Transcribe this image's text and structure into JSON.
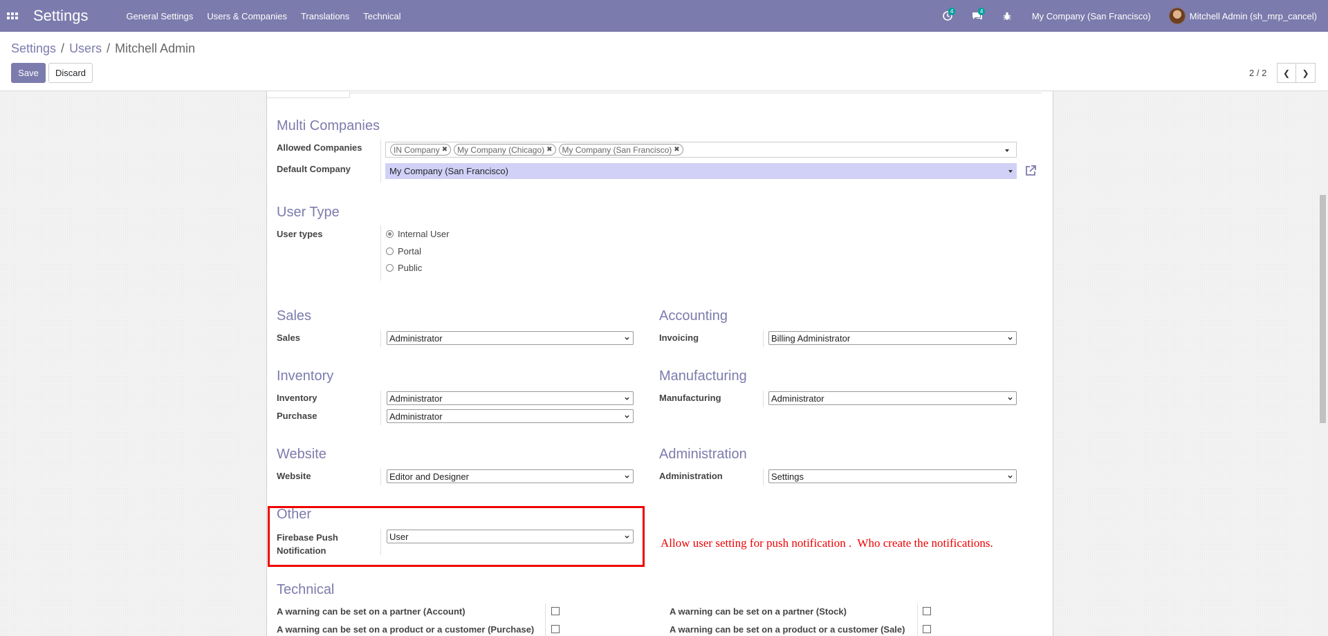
{
  "navbar": {
    "app_title": "Settings",
    "menu": [
      "General Settings",
      "Users & Companies",
      "Translations",
      "Technical"
    ],
    "activity_count": "4",
    "messages_count": "4",
    "company": "My Company (San Francisco)",
    "user": "Mitchell Admin (sh_mrp_cancel)",
    "accent_color": "#7c7bad"
  },
  "breadcrumb": [
    "Settings",
    "Users",
    "Mitchell Admin"
  ],
  "buttons": {
    "save": "Save",
    "discard": "Discard"
  },
  "pager": "2 / 2",
  "multi_companies": {
    "title": "Multi Companies",
    "allowed_label": "Allowed Companies",
    "allowed_tags": [
      "IN Company",
      "My Company (Chicago)",
      "My Company (San Francisco)"
    ],
    "default_label": "Default Company",
    "default_value": "My Company (San Francisco)"
  },
  "user_type": {
    "title": "User Type",
    "label": "User types",
    "options": [
      "Internal User",
      "Portal",
      "Public"
    ],
    "selected": "Internal User"
  },
  "sales": {
    "title": "Sales",
    "label": "Sales",
    "value": "Administrator"
  },
  "accounting": {
    "title": "Accounting",
    "label": "Invoicing",
    "value": "Billing Administrator"
  },
  "inventory": {
    "title": "Inventory",
    "inventory_label": "Inventory",
    "inventory_value": "Administrator",
    "purchase_label": "Purchase",
    "purchase_value": "Administrator"
  },
  "manufacturing": {
    "title": "Manufacturing",
    "label": "Manufacturing",
    "value": "Administrator"
  },
  "website": {
    "title": "Website",
    "label": "Website",
    "value": "Editor and Designer"
  },
  "administration": {
    "title": "Administration",
    "label": "Administration",
    "value": "Settings"
  },
  "other": {
    "title": "Other",
    "label_line1": "Firebase Push",
    "label_line2": "Notification",
    "value": "User",
    "annotation": "Allow user setting for push notification .  Who create the notifications."
  },
  "technical": {
    "title": "Technical",
    "items": [
      "A warning can be set on a partner (Account)",
      "A warning can be set on a partner (Stock)",
      "A warning can be set on a product or a customer (Purchase)",
      "A warning can be set on a product or a customer (Sale)"
    ]
  }
}
